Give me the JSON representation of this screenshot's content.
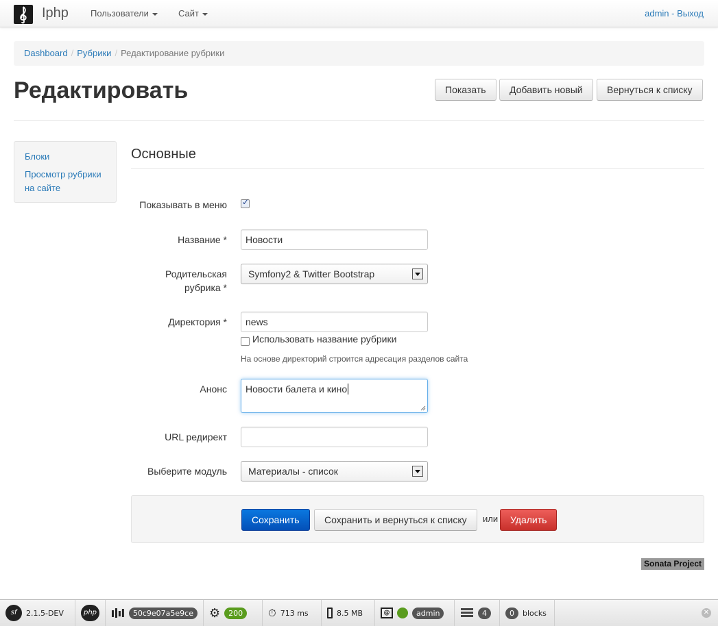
{
  "navbar": {
    "brand": "Iphp",
    "menus": [
      "Пользователи",
      "Сайт"
    ],
    "user": "admin",
    "user_sep": " - ",
    "logout": "Выход"
  },
  "breadcrumb": {
    "items": [
      "Dashboard",
      "Рубрики"
    ],
    "active": "Редактирование рубрики",
    "separator": "/"
  },
  "page": {
    "title": "Редактировать",
    "actions": [
      "Показать",
      "Добавить новый",
      "Вернуться к списку"
    ]
  },
  "side_menu": {
    "items": [
      "Блоки",
      "Просмотр рубрики на сайте"
    ]
  },
  "form": {
    "legend": "Основные",
    "show_in_menu_label": "Показывать в меню",
    "show_in_menu_checked": true,
    "name_label": "Название *",
    "name_value": "Новости",
    "parent_label_line1": "Родительская",
    "parent_label_line2": "рубрика *",
    "parent_value": "Symfony2 & Twitter Bootstrap",
    "dir_label": "Директория *",
    "dir_value": "news",
    "use_title_label": "Использовать название рубрики",
    "use_title_checked": false,
    "dir_help": "На основе директорий строится адресация разделов сайта",
    "announce_label": "Анонс",
    "announce_value": "Новости балета и кино",
    "url_label": "URL редирект",
    "url_value": "",
    "module_label": "Выберите модуль",
    "module_value": "Материалы - список"
  },
  "form_actions": {
    "save": "Сохранить",
    "save_and_list": "Сохранить и вернуться к списку",
    "or": "или",
    "delete": "Удалить"
  },
  "footer_badge": "Sonata Project",
  "toolbar": {
    "sf_version": "2.1.5-DEV",
    "php": "php",
    "token": "50c9e07a5e9ce",
    "status": "200",
    "time": "713 ms",
    "memory": "8.5 MB",
    "user": "admin",
    "queries": "4",
    "blocks_count": "0",
    "blocks_label": "blocks",
    "colors": {
      "status_ok": "#5a9c1e",
      "pill_dark": "#555555"
    }
  }
}
